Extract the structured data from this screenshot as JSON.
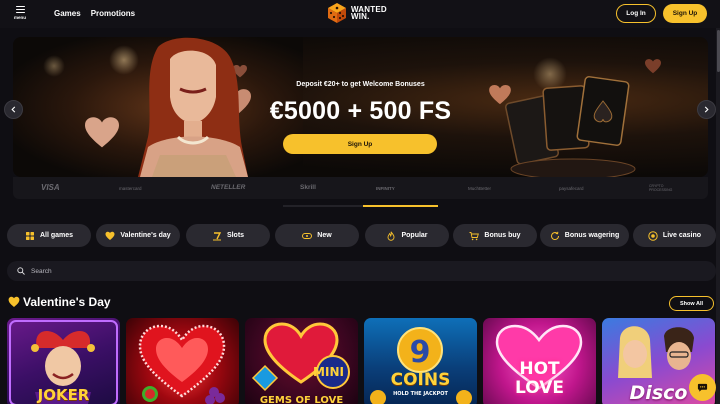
{
  "header": {
    "menu_label": "menu",
    "nav": [
      "Games",
      "Promotions"
    ],
    "logo_line1": "WANTED",
    "logo_line2": "WIN.",
    "login_label": "Log In",
    "signup_label": "Sign Up"
  },
  "banner": {
    "subtitle": "Deposit €20+ to get Welcome Bonuses",
    "headline": "€5000 + 500 FS",
    "cta_label": "Sign Up"
  },
  "payments": [
    "VISA",
    "mastercard",
    "NETELLER",
    "Skrill",
    "INFINITY",
    "MuchBetter",
    "paysafecard",
    "CRYPTO PROCESSING"
  ],
  "categories": [
    "All games",
    "Valentine's day",
    "Slots",
    "New",
    "Popular",
    "Bonus buy",
    "Bonus wagering",
    "Live casino"
  ],
  "search": {
    "placeholder": "Search"
  },
  "section": {
    "title": "Valentine's Day",
    "show_all_label": "Show All"
  },
  "games": [
    {
      "name": "JOKER",
      "top": "",
      "bottom": "JOKER"
    },
    {
      "name": "Hearts",
      "top": "",
      "bottom": ""
    },
    {
      "name": "GEMS OF LOVE",
      "top": "MINI",
      "bottom": "GEMS OF LOVE"
    },
    {
      "name": "COINS",
      "top": "COINS",
      "bottom": "HOLD THE JACKPOT"
    },
    {
      "name": "HOT LOVE",
      "top": "HOT",
      "bottom": "LOVE"
    },
    {
      "name": "Disco",
      "top": "",
      "bottom": "Disco"
    }
  ],
  "colors": {
    "accent": "#f7c12c",
    "background": "#0f0e13",
    "chip": "#2a2930"
  }
}
